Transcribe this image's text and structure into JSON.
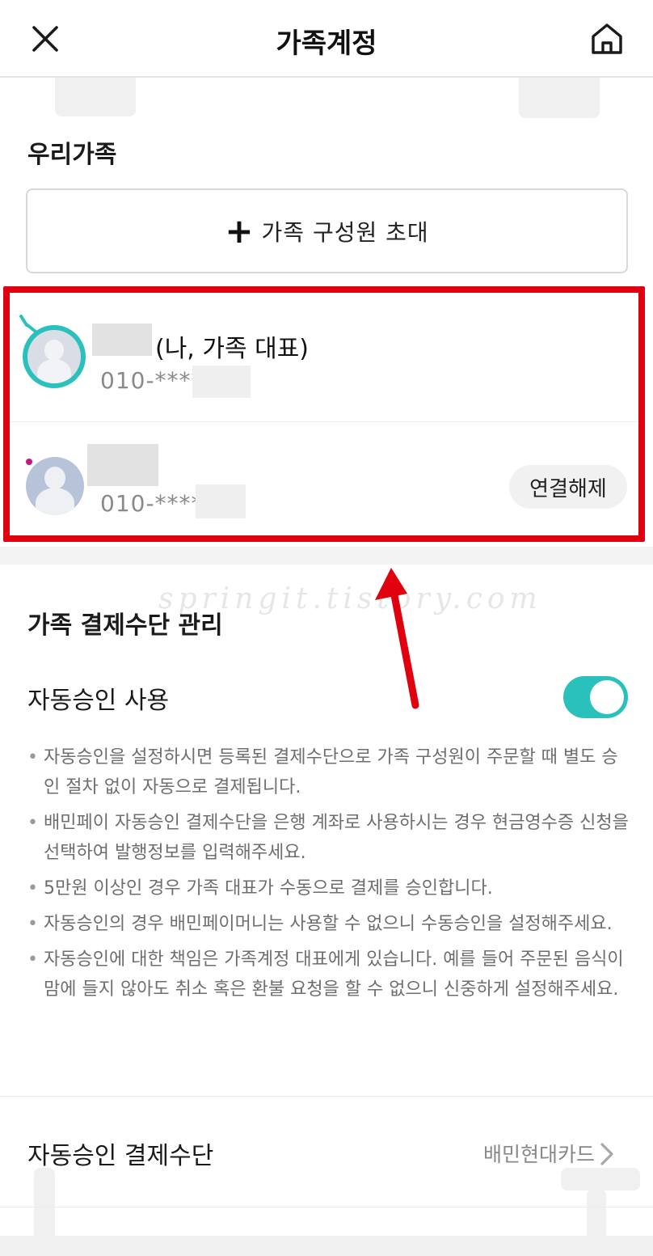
{
  "header": {
    "title": "가족계정",
    "close_icon": "close-icon",
    "home_icon": "home-icon"
  },
  "family": {
    "section_title": "우리가족",
    "invite_label": "가족 구성원 초대",
    "members": [
      {
        "name_suffix": "(나, 가족 대표)",
        "phone": "010-****-",
        "action_label": ""
      },
      {
        "name_suffix": "",
        "phone": "010-****-",
        "action_label": "연결해제"
      }
    ]
  },
  "payment": {
    "section_title": "가족 결제수단 관리",
    "auto_approve_label": "자동승인 사용",
    "auto_approve_enabled": true,
    "notes": [
      "자동승인을 설정하시면 등록된 결제수단으로 가족 구성원이 주문할 때 별도 승인 절차 없이 자동으로 결제됩니다.",
      "배민페이 자동승인 결제수단을 은행 계좌로 사용하시는 경우 현금영수증 신청을 선택하여 발행정보를 입력해주세요.",
      "5만원 이상인 경우 가족 대표가 수동으로 결제를 승인합니다.",
      "자동승인의 경우 배민페이머니는 사용할 수 없으니 수동승인을 설정해주세요.",
      "자동승인에 대한 책임은 가족계정 대표에게 있습니다. 예를 들어 주문된 음식이 맘에 들지 않아도 취소 혹은 환불 요청을 할 수 없으니 신중하게 설정해주세요."
    ],
    "method_label": "자동승인 결제수단",
    "method_value": "배민현대카드"
  },
  "overlay": {
    "watermark": "springit.tistory.com"
  },
  "colors": {
    "accent": "#2ac1bc",
    "highlight": "#e0000e"
  }
}
